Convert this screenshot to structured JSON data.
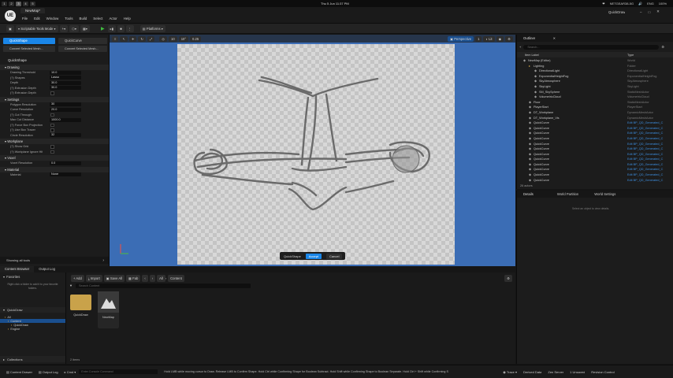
{
  "macbar": {
    "workspaces": [
      "1",
      "2",
      "3",
      "4",
      "5"
    ],
    "active_workspace": 2,
    "right_items": [
      "❤",
      "NETGEAR38-5G",
      "🔊",
      "ENG",
      "100%",
      "Thu 5 Jun 11:37 PM"
    ],
    "datetime": "Thu 5 Jun 11:37 PM"
  },
  "titlebar": {
    "logo_text": "UE",
    "tab_title": "NewMap*",
    "menu": [
      "File",
      "Edit",
      "Window",
      "Tools",
      "Build",
      "Select",
      "Actor",
      "Help"
    ],
    "project": "QuickDraw",
    "window_controls": [
      "–",
      "□",
      "✕"
    ]
  },
  "toolbar": {
    "mode": "Scriptable Tools Mode",
    "platforms": "Platforms"
  },
  "mode_panel": {
    "tools": [
      "QuickShape",
      "QuickCurve",
      "Convert Selected Mesh...",
      "Convert Selected Mesh..."
    ],
    "title": "QuickShape",
    "sections": [
      {
        "name": "Drawing",
        "rows": [
          {
            "label": "Drawing Threshold",
            "value": "10.0"
          },
          {
            "label": "(?) Shapes",
            "value": "Lasso"
          },
          {
            "label": "Depth",
            "value": "30.0"
          },
          {
            "label": "(?) Extrusion Depth",
            "value": "30.0"
          },
          {
            "label": "(?) Extrusion Depth",
            "check": true
          }
        ]
      },
      {
        "name": "Settings",
        "rows": [
          {
            "label": "Polygon Resolution",
            "value": "30"
          },
          {
            "label": "Curve Resolution",
            "value": "20.0"
          },
          {
            "label": "(?) Cut Through",
            "check": true
          },
          {
            "label": "Max Cut Distance",
            "value": "1000.0"
          },
          {
            "label": "(?) Force Box Projection",
            "check": true
          },
          {
            "label": "(?) Use Box Tracer",
            "check": true
          },
          {
            "label": "Circle Resolution",
            "value": "32"
          }
        ]
      },
      {
        "name": "Workplane",
        "rows": [
          {
            "label": "(?) Show Grid",
            "check": true
          },
          {
            "label": "(?) Workplane Ignore Hit",
            "check": true
          }
        ]
      },
      {
        "name": "Voxel",
        "rows": [
          {
            "label": "Voxel Resolution",
            "value": "0.0"
          }
        ]
      },
      {
        "name": "Material",
        "rows": [
          {
            "label": "Material",
            "value": "None"
          }
        ]
      }
    ],
    "footer": "Showing all tools"
  },
  "viewport": {
    "perspective": "Perspective",
    "lit": "Lit",
    "grid_vals": [
      "10",
      "10°",
      "0.25"
    ],
    "camera_speed": "1",
    "quickdraw_bar": {
      "label": "QuickShape",
      "accept": "Accept",
      "cancel": "Cancel"
    }
  },
  "outliner": {
    "title": "Outliner",
    "search_placeholder": "Search...",
    "col_label": "Item Label",
    "col_type": "Type",
    "rows": [
      {
        "name": "NewMap (Editor)",
        "type": "World",
        "indent": 0
      },
      {
        "name": "Lighting",
        "type": "Folder",
        "indent": 1
      },
      {
        "name": "DirectionalLight",
        "type": "DirectionalLight",
        "indent": 2
      },
      {
        "name": "ExponentialHeightFog",
        "type": "ExponentialHeightFog",
        "indent": 2
      },
      {
        "name": "SkyAtmosphere",
        "type": "SkyAtmosphere",
        "indent": 2
      },
      {
        "name": "SkyLight",
        "type": "SkyLight",
        "indent": 2
      },
      {
        "name": "SM_SkySphere",
        "type": "StaticMeshActor",
        "indent": 2
      },
      {
        "name": "VolumetricCloud",
        "type": "VolumetricCloud",
        "indent": 2
      },
      {
        "name": "Floor",
        "type": "StaticMeshActor",
        "indent": 1
      },
      {
        "name": "PlayerStart",
        "type": "PlayerStart",
        "indent": 1
      },
      {
        "name": "DT_Workplane",
        "type": "DynamicMeshActor",
        "indent": 1
      },
      {
        "name": "DT_Workplane_Vis",
        "type": "DynamicMeshActor",
        "indent": 1
      },
      {
        "name": "QuickCurve",
        "type": "Edit BP_QD_Generated_C",
        "indent": 1
      },
      {
        "name": "QuickCurve",
        "type": "Edit BP_QD_Generated_C",
        "indent": 1
      },
      {
        "name": "QuickCurve",
        "type": "Edit BP_QD_Generated_C",
        "indent": 1
      },
      {
        "name": "QuickCurve",
        "type": "Edit BP_QD_Generated_C",
        "indent": 1
      },
      {
        "name": "QuickCurve",
        "type": "Edit BP_QD_Generated_C",
        "indent": 1
      },
      {
        "name": "QuickCurve",
        "type": "Edit BP_QD_Generated_C",
        "indent": 1
      },
      {
        "name": "QuickCurve",
        "type": "Edit BP_QD_Generated_C",
        "indent": 1
      },
      {
        "name": "QuickCurve",
        "type": "Edit BP_QD_Generated_C",
        "indent": 1
      },
      {
        "name": "QuickCurve",
        "type": "Edit BP_QD_Generated_C",
        "indent": 1
      },
      {
        "name": "QuickCurve",
        "type": "Edit BP_QD_Generated_C",
        "indent": 1
      },
      {
        "name": "QuickCurve",
        "type": "Edit BP_QD_Generated_C",
        "indent": 1
      },
      {
        "name": "QuickCurve",
        "type": "Edit BP_QD_Generated_C",
        "indent": 1
      },
      {
        "name": "QuickCurve",
        "type": "Edit BP_QD_Generated_C",
        "indent": 1
      },
      {
        "name": "QuickCurve",
        "type": "Edit BP_QD_Generated_C",
        "indent": 1
      }
    ],
    "actor_count": "26 actors"
  },
  "details": {
    "tabs": [
      "Details",
      "World Partition",
      "World Settings"
    ],
    "empty_text": "Select an object to view details."
  },
  "content_browser": {
    "tabs": [
      "Content Browser",
      "Output Log"
    ],
    "add": "Add",
    "import": "Import",
    "save_all": "Save All",
    "fab": "Fab",
    "path": [
      "All",
      "Content"
    ],
    "search_placeholder": "Search Content",
    "favorites": "Favorites",
    "favorites_hint": "Right click a folder to add it to your favorite folders.",
    "project_root": "QuickDraw",
    "tree": [
      "All",
      "Content",
      "QuickDraw",
      "Engine"
    ],
    "assets": [
      {
        "name": "QuickDraw",
        "kind": "folder"
      },
      {
        "name": "NewMap",
        "kind": "level"
      }
    ],
    "item_count": "2 items",
    "collections": "Collections"
  },
  "statusbar": {
    "content_drawer": "Content Drawer",
    "output_log": "Output Log",
    "cmd": "Cmd",
    "console_placeholder": "Enter Console Command",
    "hint": "Hold LMB while moving cursor to Draw. Release LMB to Confirm Shape. Hold Ctrl while Confirming Shape for Boolean Subtract. Hold Shift while Confirming Shape to Boolean Separate. Hold Ctrl + Shift while Confirming S",
    "trace": "Trace",
    "derived": "Derived Data",
    "zen": "Zen Server",
    "unsaved": "1 Unsaved",
    "revision": "Revision Control"
  },
  "colors": {
    "accent": "#1a86e8",
    "accept": "#1a86e8",
    "viewport_bg": "#3b6db5"
  }
}
